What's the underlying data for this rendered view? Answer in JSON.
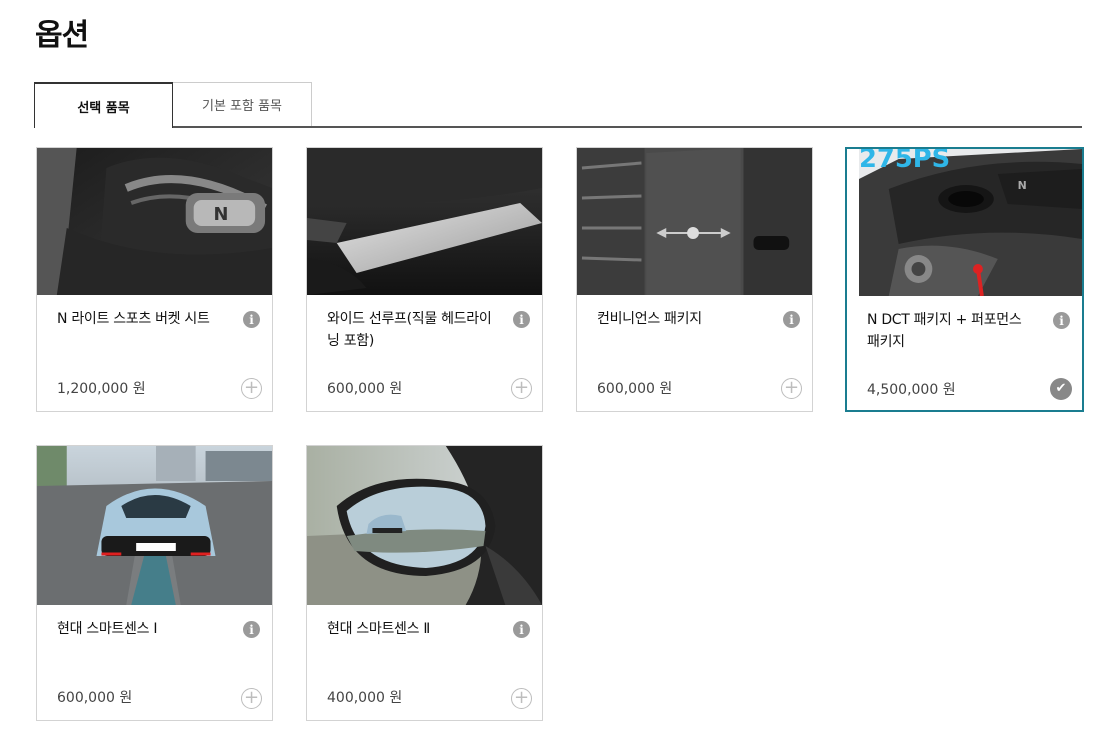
{
  "page": {
    "title": "옵션"
  },
  "tabs": [
    {
      "label": "선택 품목",
      "active": true
    },
    {
      "label": "기본 포함 품목",
      "active": false
    }
  ],
  "options": [
    {
      "name": "N 라이트 스포츠 버켓 시트",
      "price": "1,200,000 원",
      "selected": false,
      "info_icon": "info-icon",
      "action_icon": "plus-circle-icon"
    },
    {
      "name": "와이드 선루프(직물 헤드라이닝 포함)",
      "price": "600,000 원",
      "selected": false,
      "info_icon": "info-icon",
      "action_icon": "plus-circle-icon"
    },
    {
      "name": "컨비니언스 패키지",
      "price": "600,000 원",
      "selected": false,
      "info_icon": "info-icon",
      "action_icon": "plus-circle-icon"
    },
    {
      "name": "N DCT 패키지 + 퍼포먼스 패키지",
      "price": "4,500,000 원",
      "selected": true,
      "photo_text": "275PS",
      "info_icon": "info-icon",
      "action_icon": "check-circle-icon"
    },
    {
      "name": "현대 스마트센스 Ⅰ",
      "price": "600,000 원",
      "selected": false,
      "info_icon": "info-icon",
      "action_icon": "plus-circle-icon"
    },
    {
      "name": "현대 스마트센스 Ⅱ",
      "price": "400,000 원",
      "selected": false,
      "info_icon": "info-icon",
      "action_icon": "plus-circle-icon"
    }
  ],
  "colors": {
    "selected_border": "#1a7d90",
    "icon_gray": "#9a9a9a"
  }
}
